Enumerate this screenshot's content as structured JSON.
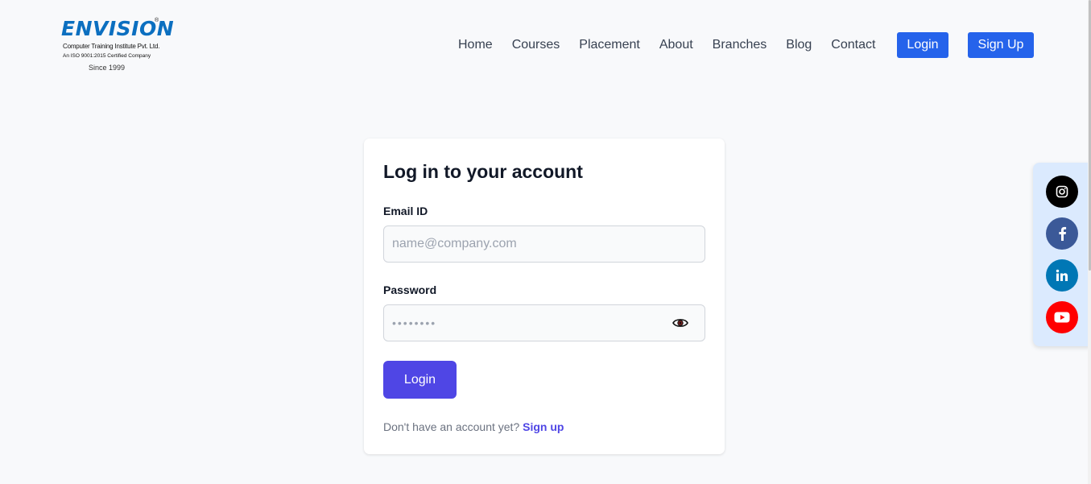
{
  "logo": {
    "word": "ENVISION",
    "reg": "®",
    "line1": "Computer Training Institute Pvt. Ltd.",
    "line2": "An ISO 9001:2015 Certified Company",
    "line3": "Since 1999"
  },
  "nav": {
    "items": [
      "Home",
      "Courses",
      "Placement",
      "About",
      "Branches",
      "Blog",
      "Contact"
    ],
    "login_label": "Login",
    "signup_label": "Sign Up"
  },
  "form": {
    "title": "Log in to your account",
    "email_label": "Email ID",
    "email_placeholder": "name@company.com",
    "password_label": "Password",
    "password_placeholder": "••••••••",
    "login_button": "Login",
    "signup_prompt": "Don't have an account yet?",
    "signup_link": "Sign up"
  },
  "social": {
    "icons": [
      "instagram-icon",
      "facebook-icon",
      "linkedin-icon",
      "youtube-icon"
    ]
  },
  "colors": {
    "brand_blue": "#2563eb",
    "primary_indigo": "#4f46e5",
    "logo_blue": "#0b6fc0",
    "instagram": "#000000",
    "facebook": "#3b5998",
    "linkedin": "#0077b5",
    "youtube": "#ff0000"
  }
}
